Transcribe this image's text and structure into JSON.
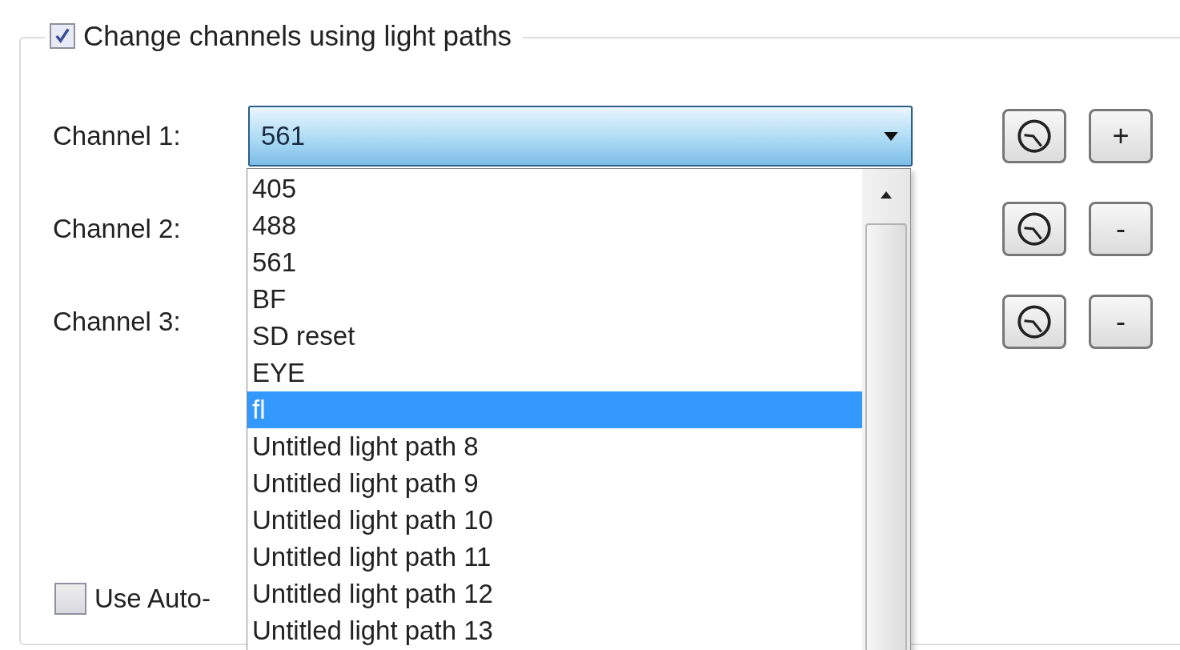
{
  "group": {
    "label": "Change channels using light paths",
    "checked": true
  },
  "channels": [
    {
      "label": "Channel 1:",
      "value": "561",
      "button": "+"
    },
    {
      "label": "Channel 2:",
      "button": "-"
    },
    {
      "label": "Channel 3:",
      "button": "-"
    }
  ],
  "auto_checkbox": {
    "label": "Use Auto-",
    "checked": false
  },
  "dropdown_options": [
    {
      "label": "405",
      "selected": false
    },
    {
      "label": "488",
      "selected": false
    },
    {
      "label": "561",
      "selected": false
    },
    {
      "label": "BF",
      "selected": false
    },
    {
      "label": "SD reset",
      "selected": false
    },
    {
      "label": "EYE",
      "selected": false
    },
    {
      "label": "fl",
      "selected": true
    },
    {
      "label": "Untitled light path 8",
      "selected": false
    },
    {
      "label": "Untitled light path 9",
      "selected": false
    },
    {
      "label": "Untitled light path 10",
      "selected": false
    },
    {
      "label": "Untitled light path 11",
      "selected": false
    },
    {
      "label": "Untitled light path 12",
      "selected": false
    },
    {
      "label": "Untitled light path 13",
      "selected": false
    }
  ]
}
